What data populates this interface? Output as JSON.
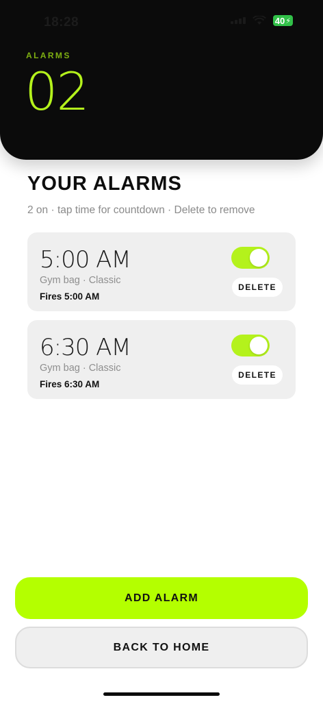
{
  "status_bar": {
    "time": "18:28",
    "battery": "40"
  },
  "header": {
    "label": "ALARMS",
    "count": "02"
  },
  "section": {
    "title": "YOUR ALARMS",
    "subtitle": "2 on · tap time for countdown · Delete to remove"
  },
  "alarms": [
    {
      "time": "5:00 AM",
      "meta": "Gym bag · Classic",
      "fires": "Fires 5:00 AM",
      "enabled": true,
      "delete_label": "DELETE"
    },
    {
      "time": "6:30 AM",
      "meta": "Gym bag · Classic",
      "fires": "Fires 6:30 AM",
      "enabled": true,
      "delete_label": "DELETE"
    }
  ],
  "buttons": {
    "add": "ADD ALARM",
    "back": "BACK TO HOME"
  },
  "colors": {
    "accent": "#b4ff00",
    "header_bg": "#0b0b0b",
    "card_bg": "#efefef"
  }
}
